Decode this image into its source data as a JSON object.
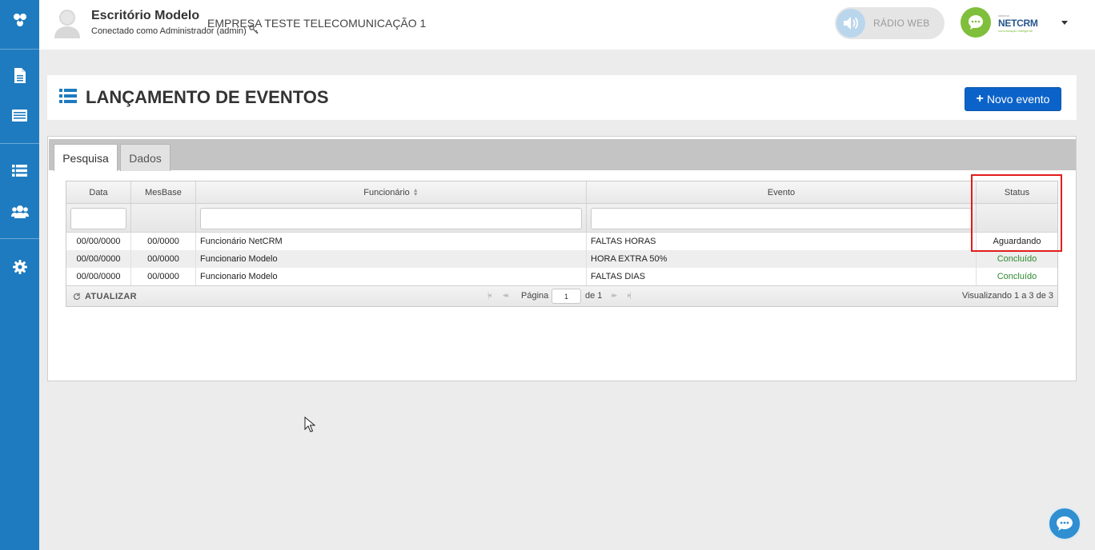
{
  "header": {
    "company": "Escritório Modelo",
    "connected_as": "Conectado como Administrador (admin)",
    "subcompany": "EMPRESA TESTE TELECOMUNICAÇÃO 1",
    "radio_label": "RÁDIO WEB",
    "brand_name": "NETCRM",
    "brand_top": "sistema",
    "brand_tagline": "comunicação inteligente"
  },
  "page": {
    "title": "LANÇAMENTO DE EVENTOS",
    "new_button_label": "Novo evento"
  },
  "tabs": [
    {
      "label": "Pesquisa",
      "active": true
    },
    {
      "label": "Dados",
      "active": false
    }
  ],
  "grid": {
    "columns": [
      "Data",
      "MesBase",
      "Funcionário",
      "Evento",
      "Status"
    ],
    "rows": [
      {
        "data": "00/00/0000",
        "mesbase": "00/0000",
        "funcionario": "Funcionário NetCRM",
        "evento": "FALTAS HORAS",
        "status": "Aguardando"
      },
      {
        "data": "00/00/0000",
        "mesbase": "00/0000",
        "funcionario": "Funcionario Modelo",
        "evento": "HORA EXTRA 50%",
        "status": "Concluído"
      },
      {
        "data": "00/00/0000",
        "mesbase": "00/0000",
        "funcionario": "Funcionario Modelo",
        "evento": "FALTAS DIAS",
        "status": "Concluído"
      }
    ],
    "pager": {
      "refresh_label": "ATUALIZAR",
      "page_label": "Página",
      "page_value": "1",
      "of_label": "de 1",
      "view_info": "Visualizando 1 a 3 de 3"
    }
  },
  "colors": {
    "sidebar": "#1e7bbf",
    "primary_button": "#0b63c9",
    "status_done": "#2e8b2e",
    "highlight": "#e21c1c"
  }
}
